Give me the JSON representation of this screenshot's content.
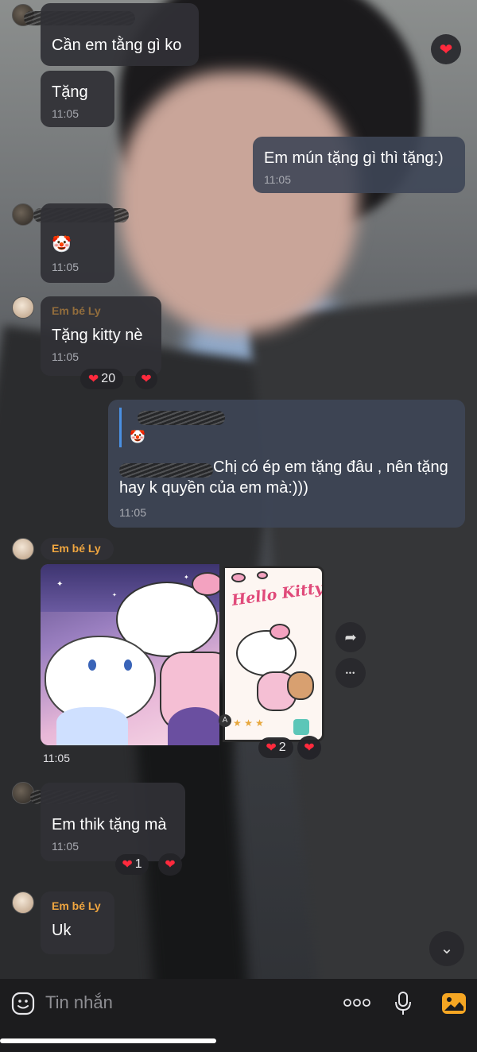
{
  "messages": {
    "m1": {
      "text": "Cần em tằng gì ko"
    },
    "m2": {
      "text": "Tặng",
      "time": "11:05"
    },
    "m3": {
      "text": "Em mún tặng gì thì tặng:)",
      "time": "11:05"
    },
    "m4": {
      "emoji": "🤡",
      "time": "11:05"
    },
    "m5": {
      "sender": "Em bé Ly",
      "text": "Tặng kitty nè",
      "time": "11:05",
      "reaction_count": "20"
    },
    "m6": {
      "quoted_emoji": "🤡",
      "text": "Chị có ép em tặng đâu , nên tặng hay k quyền của em mà:)))",
      "time": "11:05"
    },
    "m7": {
      "sender": "Em bé Ly",
      "time": "11:05",
      "reaction_count": "2"
    },
    "m8": {
      "text": "Em thik tặng mà",
      "time": "11:05",
      "reaction_count": "1"
    },
    "m9": {
      "sender": "Em bé Ly",
      "text": "Uk"
    }
  },
  "images": {
    "hello_kitty_title": "Hello Kitty",
    "badge": "A"
  },
  "composer": {
    "placeholder": "Tin nhắn"
  },
  "icons": {
    "heart": "❤",
    "forward": "➦",
    "more": "•••",
    "scroll_down": "⌄",
    "sticker": "sticker-icon",
    "mic": "mic-icon",
    "gallery": "gallery-icon"
  },
  "colors": {
    "sender_name": "#f0a640",
    "heart": "#ff2a3d",
    "gallery_accent": "#f5a623"
  }
}
